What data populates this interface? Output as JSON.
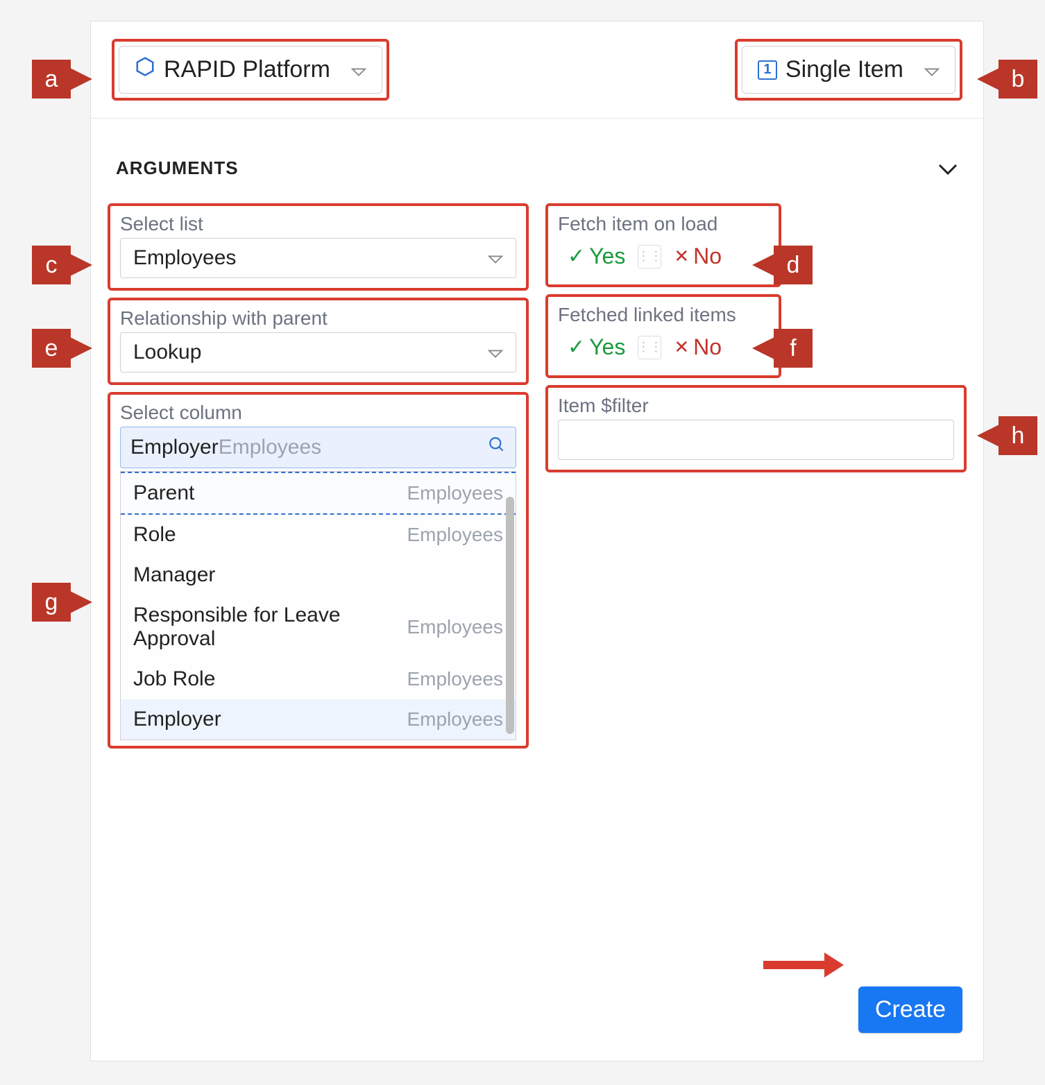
{
  "annotations": {
    "a": "a",
    "b": "b",
    "c": "c",
    "d": "d",
    "e": "e",
    "f": "f",
    "g": "g",
    "h": "h"
  },
  "header": {
    "platform_label": "RAPID Platform",
    "item_type_label": "Single Item",
    "item_type_icon_text": "1"
  },
  "section": {
    "title": "ARGUMENTS"
  },
  "fields": {
    "select_list": {
      "label": "Select list",
      "value": "Employees"
    },
    "fetch_on_load": {
      "label": "Fetch item on load",
      "yes": "Yes",
      "no": "No"
    },
    "relationship": {
      "label": "Relationship with parent",
      "value": "Lookup"
    },
    "fetched_linked": {
      "label": "Fetched linked items",
      "yes": "Yes",
      "no": "No"
    },
    "select_column": {
      "label": "Select column",
      "typed": "Employer",
      "hint": "Employees"
    },
    "item_filter": {
      "label": "Item $filter",
      "value": ""
    }
  },
  "dropdown": {
    "options": [
      {
        "label": "Parent",
        "sub": "Employees"
      },
      {
        "label": "Role",
        "sub": "Employees"
      },
      {
        "label": "Manager",
        "sub": ""
      },
      {
        "label": "Responsible for Leave Approval",
        "sub": "Employees"
      },
      {
        "label": "Job Role",
        "sub": "Employees"
      },
      {
        "label": "Employer",
        "sub": "Employees"
      }
    ]
  },
  "buttons": {
    "create": "Create"
  }
}
